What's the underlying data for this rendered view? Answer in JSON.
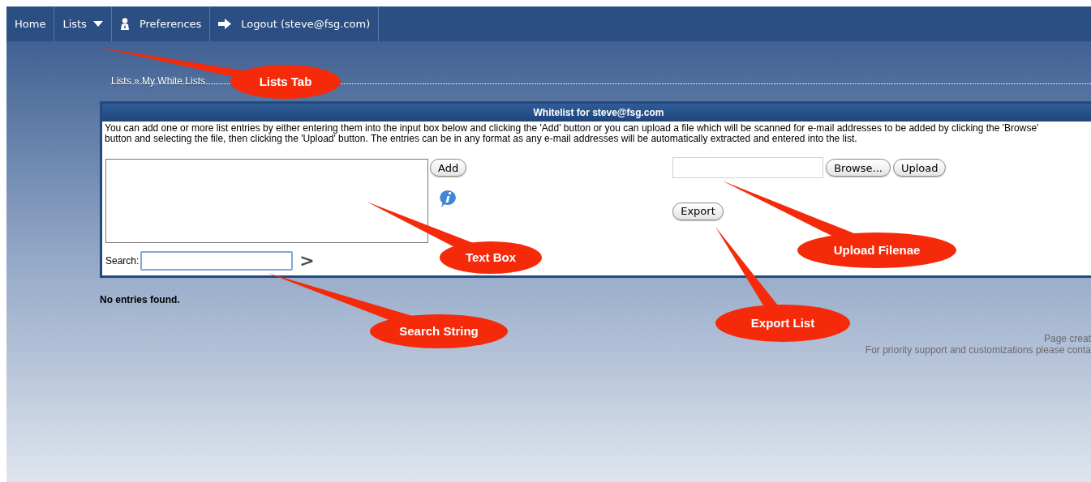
{
  "nav": {
    "items": [
      {
        "label": "Home",
        "kind": "plain"
      },
      {
        "label": "Lists",
        "kind": "dropdown"
      },
      {
        "label": "Preferences",
        "kind": "preferences"
      },
      {
        "label": "Logout (steve@fsg.com)",
        "kind": "logout"
      }
    ]
  },
  "breadcrumb": "Lists » My White Lists",
  "panel": {
    "title": "Whitelist for steve@fsg.com",
    "description": "You can add one or more list entries by either entering them into the input box below and clicking the 'Add' button or you can upload a file which will be scanned for e-mail addresses to be added by clicking the 'Browse' button and selecting the file, then clicking the 'Upload' button. The entries can be in any format as any e-mail addresses will be automatically extracted and entered into the list.",
    "add_button": "Add",
    "browse_button": "Browse...",
    "upload_button": "Upload",
    "export_button": "Export",
    "search_label": "Search:",
    "search_go": ">"
  },
  "status": "No entries found.",
  "footer": [
    "Page creat",
    "For priority support and customizations please conta"
  ],
  "callouts": [
    {
      "text": "Lists Tab"
    },
    {
      "text": "Text Box"
    },
    {
      "text": "Search String"
    },
    {
      "text": "Upload Filenae"
    },
    {
      "text": "Export List"
    }
  ]
}
